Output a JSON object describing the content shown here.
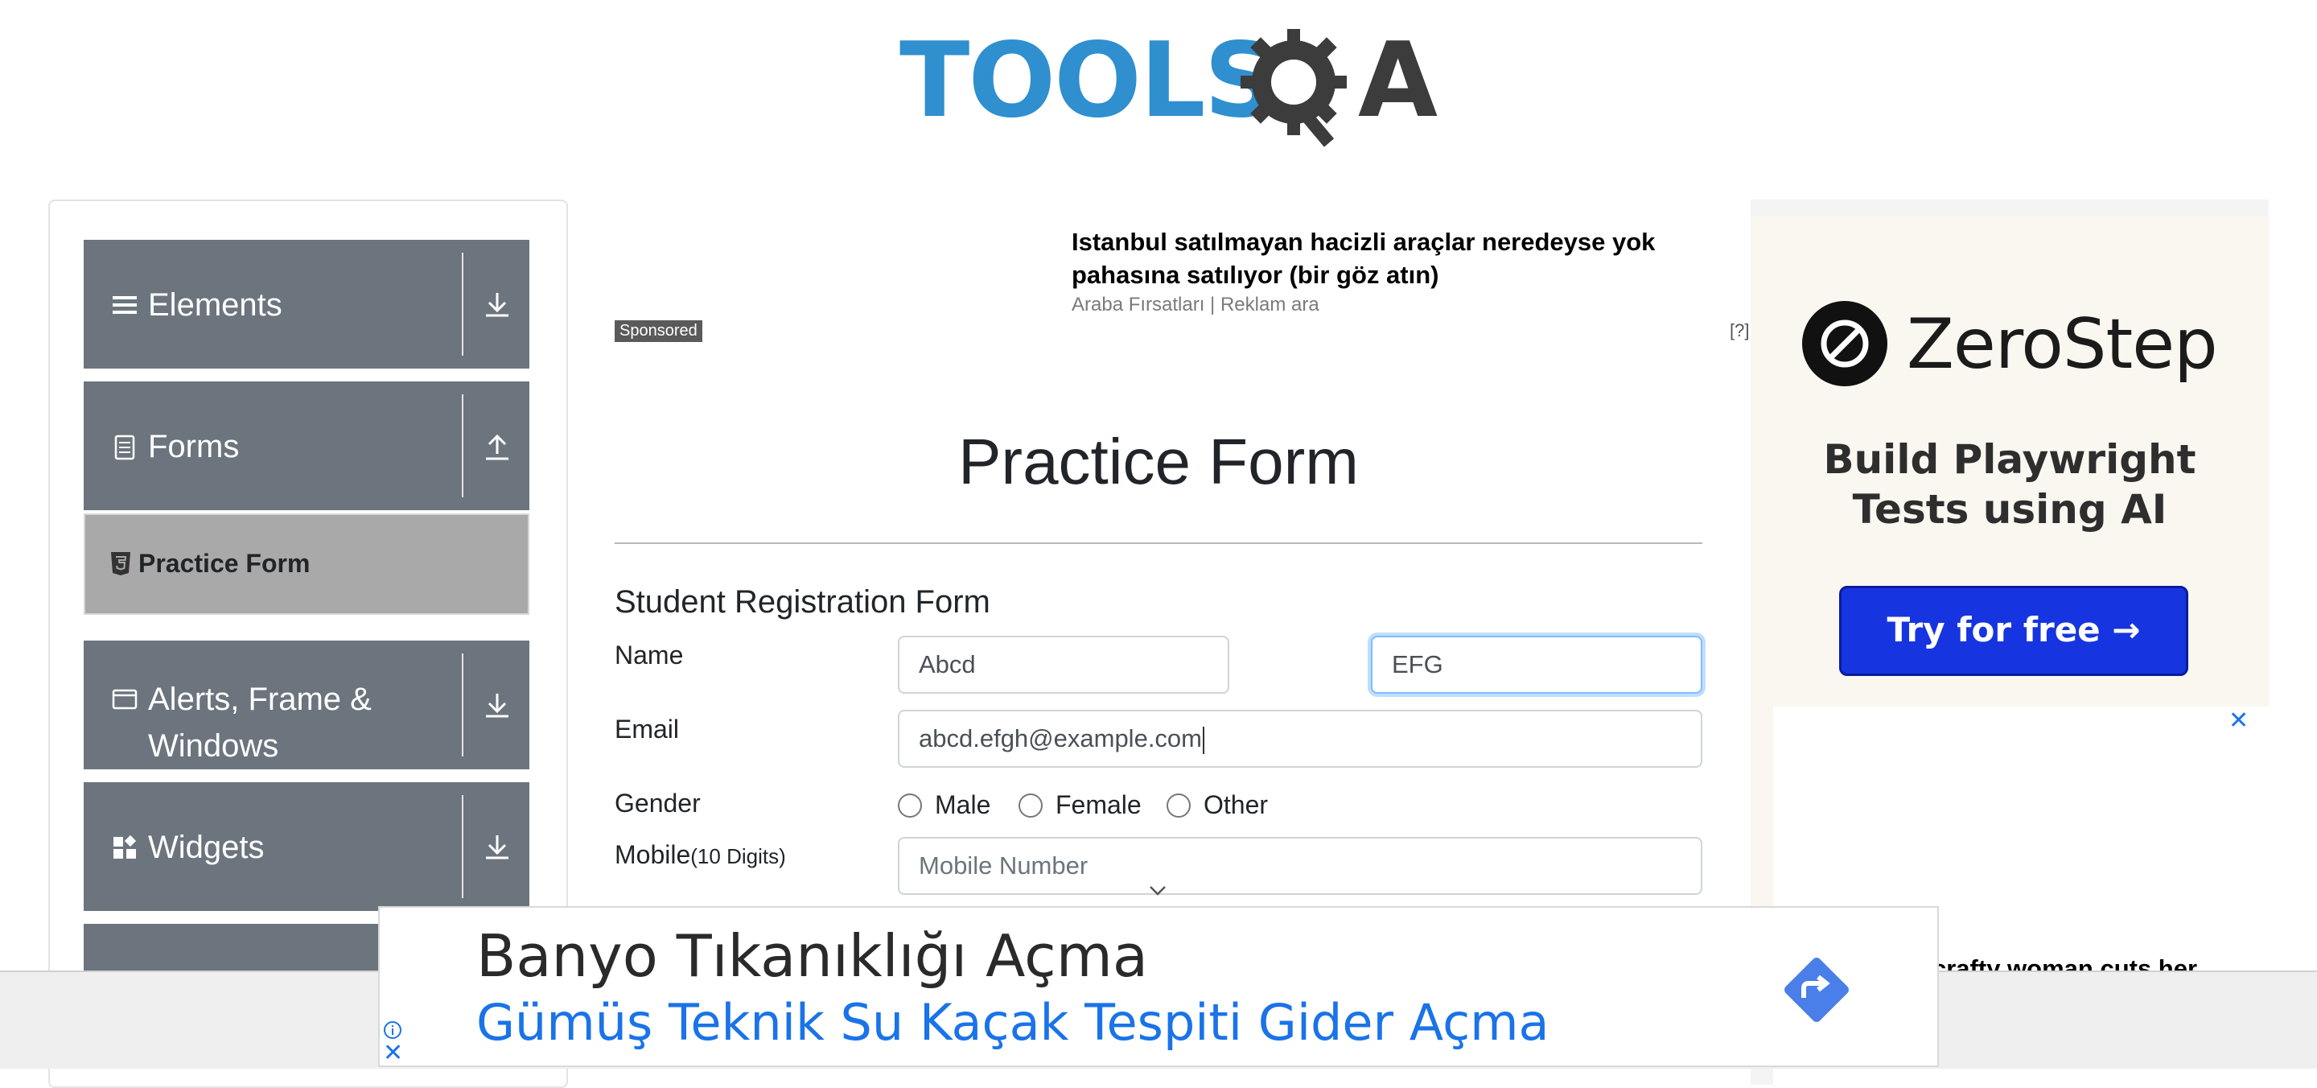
{
  "header": {
    "logo_tools": "TOOLS",
    "logo_a": "A",
    "logo_icon": "gear-magnifier-icon"
  },
  "sidebar": {
    "groups": [
      {
        "label": "Elements",
        "icon": "hamburger-icon",
        "toggle_icon": "download-arrow-icon"
      },
      {
        "label": "Forms",
        "icon": "document-icon",
        "toggle_icon": "upload-arrow-icon"
      },
      {
        "label": "Alerts, Frame & Windows",
        "icon": "window-icon",
        "toggle_icon": "download-arrow-icon"
      },
      {
        "label": "Widgets",
        "icon": "widgets-icon",
        "toggle_icon": "download-arrow-icon"
      }
    ],
    "active_item": {
      "label": "Practice Form",
      "icon": "html5-icon"
    }
  },
  "top_ad": {
    "title": "Istanbul satılmayan hacizli araçlar neredeyse yok pahasına satılıyor (bir göz atın)",
    "source": "Araba Fırsatları | Reklam ara",
    "sponsored": "Sponsored",
    "help": "[?]"
  },
  "form": {
    "page_title": "Practice Form",
    "subtitle": "Student Registration Form",
    "name_label": "Name",
    "first_name": "Abcd",
    "last_name": "EFG",
    "email_label": "Email",
    "email": "abcd.efgh@example.com",
    "gender_label": "Gender",
    "gender_options": [
      "Male",
      "Female",
      "Other"
    ],
    "mobile_label": "Mobile",
    "mobile_hint": "(10 Digits)",
    "mobile_placeholder": "Mobile Number"
  },
  "right_ad": {
    "brand": "ZeroStep",
    "tagline_line1": "Build Playwright",
    "tagline_line2": "Tests using AI",
    "cta": "Try for free →",
    "close": "✕",
    "teaser": "crafty woman cuts her"
  },
  "bottom_banner": {
    "title": "Banyo Tıkanıklığı Açma",
    "subtitle": "Gümüş Teknik Su Kaçak Tespiti Gider Açma",
    "close": "✕",
    "colors": {
      "link": "#1a73e8",
      "arrow": "#4a7ee8"
    }
  },
  "colors": {
    "sidebar_header": "#6c757d",
    "active_item": "#a9a9a9",
    "logo_blue": "#2f8fcf",
    "cta_blue": "#1635e0"
  }
}
